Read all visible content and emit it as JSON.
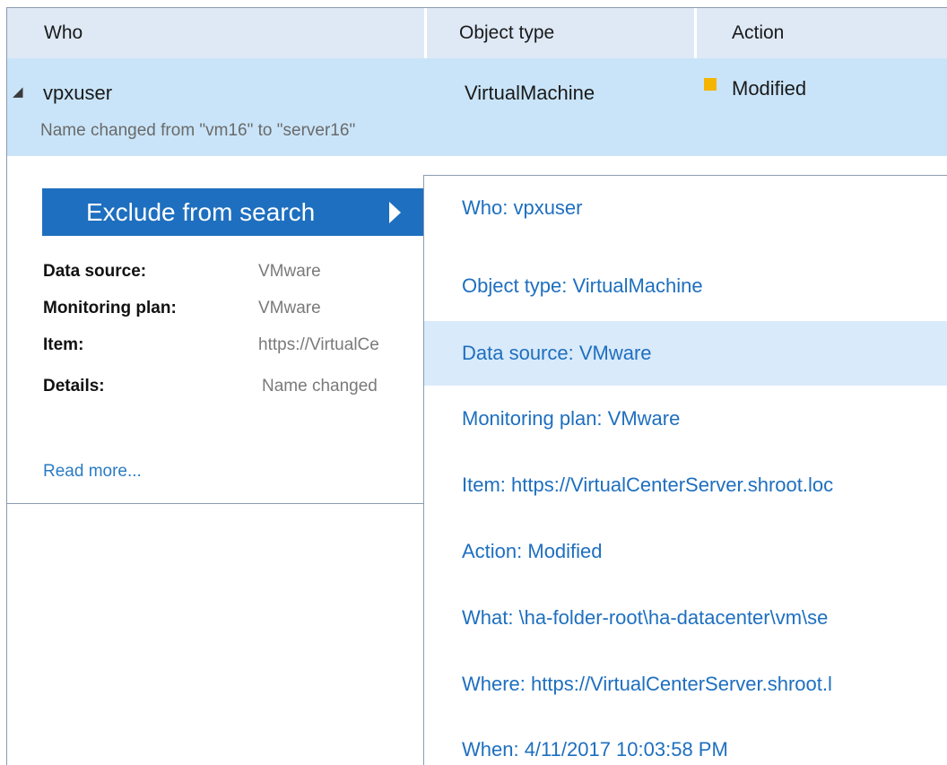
{
  "header": {
    "who": "Who",
    "object_type": "Object type",
    "action": "Action"
  },
  "selected_row": {
    "who": "vpxuser",
    "object_type": "VirtualMachine",
    "action": "Modified",
    "action_color": "#f5b400",
    "description": "Name changed from \"vm16\" to \"server16\""
  },
  "detail": {
    "exclude_button": "Exclude from search",
    "fields": [
      {
        "key": "Data source:",
        "value": "VMware"
      },
      {
        "key": "Monitoring plan:",
        "value": "VMware"
      },
      {
        "key": "Item:",
        "value": "https://VirtualCe"
      },
      {
        "key": "Details:",
        "value": "Name changed"
      }
    ],
    "read_more": "Read more..."
  },
  "menu": {
    "items": [
      "Who: vpxuser",
      "Object type: VirtualMachine",
      "Data source: VMware",
      "Monitoring plan: VMware",
      "Item: https://VirtualCenterServer.shroot.loc",
      "Action: Modified",
      "What: \\ha-folder-root\\ha-datacenter\\vm\\se",
      "Where: https://VirtualCenterServer.shroot.l",
      "When: 4/11/2017 10:03:58 PM"
    ],
    "highlighted_index": 2
  },
  "colors": {
    "accent": "#1e6fbf",
    "header_bg": "#dfe9f6",
    "selected_row_bg": "#c9e4f8",
    "menu_highlight_bg": "#d9eafa"
  }
}
